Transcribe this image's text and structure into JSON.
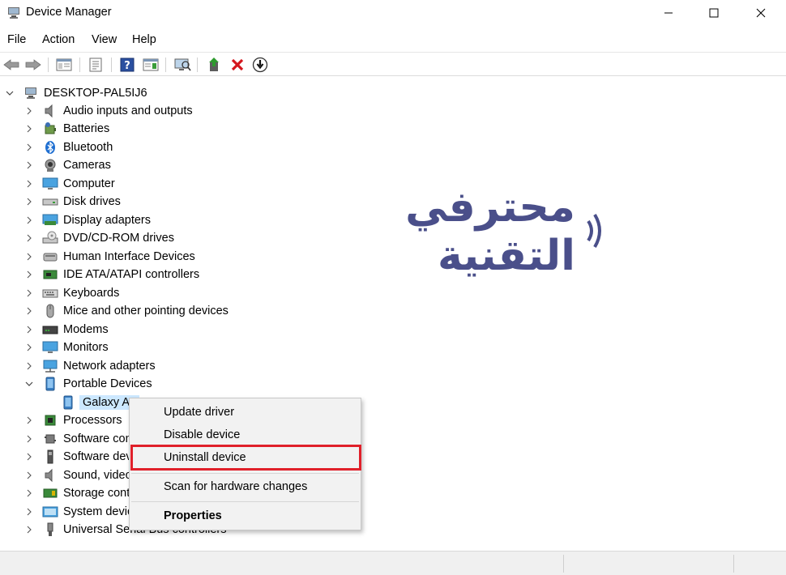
{
  "window": {
    "title": "Device Manager",
    "controls": {
      "minimize": "—",
      "maximize": "☐",
      "close": "✕"
    }
  },
  "menu": [
    "File",
    "Action",
    "View",
    "Help"
  ],
  "toolbar": {
    "buttons": [
      "back-arrow-icon",
      "forward-arrow-icon",
      "console-tree-icon",
      "properties-icon",
      "help-icon",
      "action-pane-icon",
      "scan-hardware-icon",
      "update-driver-icon",
      "uninstall-icon",
      "disable-icon"
    ]
  },
  "tree": {
    "root": "DESKTOP-PAL5IJ6",
    "categories": [
      "Audio inputs and outputs",
      "Batteries",
      "Bluetooth",
      "Cameras",
      "Computer",
      "Disk drives",
      "Display adapters",
      "DVD/CD-ROM drives",
      "Human Interface Devices",
      "IDE ATA/ATAPI controllers",
      "Keyboards",
      "Mice and other pointing devices",
      "Modems",
      "Monitors",
      "Network adapters",
      "Portable Devices",
      "Processors",
      "Software components",
      "Software devices",
      "Sound, video and game controllers",
      "Storage controllers",
      "System devices",
      "Universal Serial Bus controllers"
    ],
    "expanded_child": "Galaxy A3"
  },
  "context_menu": {
    "items": [
      "Update driver",
      "Disable device",
      "Uninstall device",
      "Scan for hardware changes",
      "Properties"
    ],
    "highlighted": "Uninstall device"
  },
  "watermark": "محترفي التقنية",
  "colors": {
    "selection": "#cce8ff",
    "highlight_box": "#e0202a",
    "watermark": "#4a4f8a",
    "uninstall_x": "#d4161d"
  }
}
